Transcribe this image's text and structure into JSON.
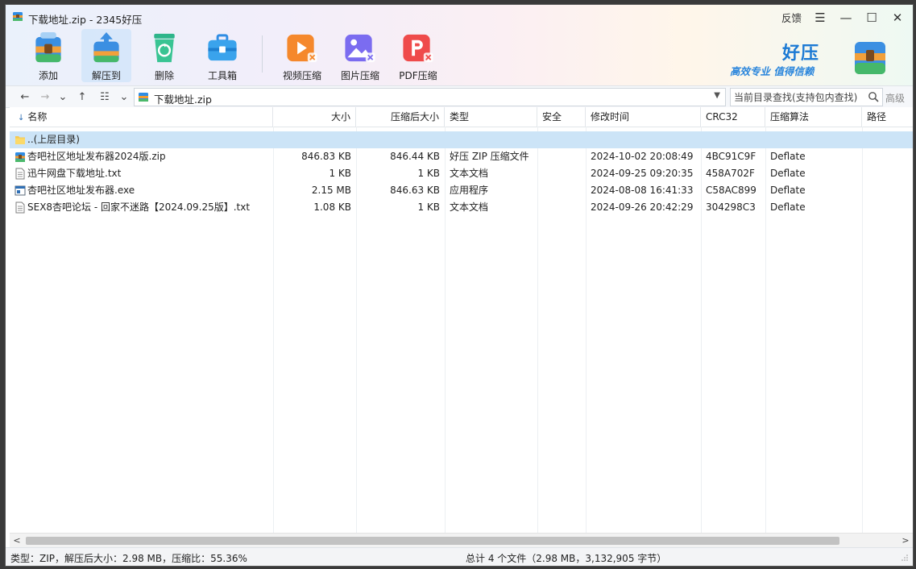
{
  "window": {
    "title": "下载地址.zip - 2345好压",
    "feedback_label": "反馈",
    "menu_glyph": "☰",
    "minimize_glyph": "—",
    "maximize_glyph": "☐",
    "close_glyph": "✕"
  },
  "toolbar": {
    "tools": [
      {
        "label": "添加",
        "icon": "add-archive-icon"
      },
      {
        "label": "解压到",
        "icon": "extract-icon"
      },
      {
        "label": "删除",
        "icon": "recycle-delete-icon"
      },
      {
        "label": "工具箱",
        "icon": "toolbox-icon"
      },
      {
        "label": "视频压缩",
        "icon": "video-compress-icon"
      },
      {
        "label": "图片压缩",
        "icon": "image-compress-icon"
      },
      {
        "label": "PDF压缩",
        "icon": "pdf-compress-icon"
      }
    ],
    "active_tool": "解压到"
  },
  "brand": {
    "name": "好压",
    "slogan": "高效专业 值得信赖"
  },
  "navbar": {
    "back_glyph": "←",
    "forward_glyph": "→",
    "history_glyph": "⌄",
    "up_glyph": "↑",
    "view_glyph": "☷",
    "view_drop_glyph": "⌄",
    "path": "下载地址.zip",
    "path_drop_glyph": "▼",
    "search_placeholder": "当前目录查找(支持包内查找)",
    "advanced_label": "高级"
  },
  "columns": {
    "name": "名称",
    "sort_glyph": "↓",
    "size": "大小",
    "packed": "压缩后大小",
    "type": "类型",
    "security": "安全",
    "modified": "修改时间",
    "crc": "CRC32",
    "method": "压缩算法",
    "path": "路径"
  },
  "files": [
    {
      "name": "..(上层目录)",
      "size": "",
      "packed": "",
      "type": "",
      "security": "",
      "modified": "",
      "crc": "",
      "method": "",
      "icon": "folder-icon",
      "selected": true
    },
    {
      "name": "杏吧社区地址发布器2024版.zip",
      "size": "846.83 KB",
      "packed": "846.44 KB",
      "type": "好压 ZIP 压缩文件",
      "security": "",
      "modified": "2024-10-02 20:08:49",
      "crc": "4BC91C9F",
      "method": "Deflate",
      "icon": "zip-archive-icon",
      "selected": false
    },
    {
      "name": "迅牛网盘下载地址.txt",
      "size": "1 KB",
      "packed": "1 KB",
      "type": "文本文档",
      "security": "",
      "modified": "2024-09-25 09:20:35",
      "crc": "458A702F",
      "method": "Deflate",
      "icon": "text-file-icon",
      "selected": false
    },
    {
      "name": "杏吧社区地址发布器.exe",
      "size": "2.15 MB",
      "packed": "846.63 KB",
      "type": "应用程序",
      "security": "",
      "modified": "2024-08-08 16:41:33",
      "crc": "C58AC899",
      "method": "Deflate",
      "icon": "exe-file-icon",
      "selected": false
    },
    {
      "name": " SEX8杏吧论坛 - 回家不迷路【2024.09.25版】.txt",
      "size": "1.08 KB",
      "packed": "1 KB",
      "type": "文本文档",
      "security": "",
      "modified": "2024-09-26 20:42:29",
      "crc": "304298C3",
      "method": "Deflate",
      "icon": "text-file-icon",
      "selected": false
    }
  ],
  "scroll": {
    "left_glyph": "<",
    "right_glyph": ">"
  },
  "status": {
    "left": "类型：ZIP，解压后大小：2.98 MB，压缩比：55.36%",
    "summary": "总计 4 个文件（2.98 MB，3,132,905 字节）"
  },
  "colors": {
    "selection": "#cce4f7",
    "brand_blue": "#1c7ad4"
  }
}
